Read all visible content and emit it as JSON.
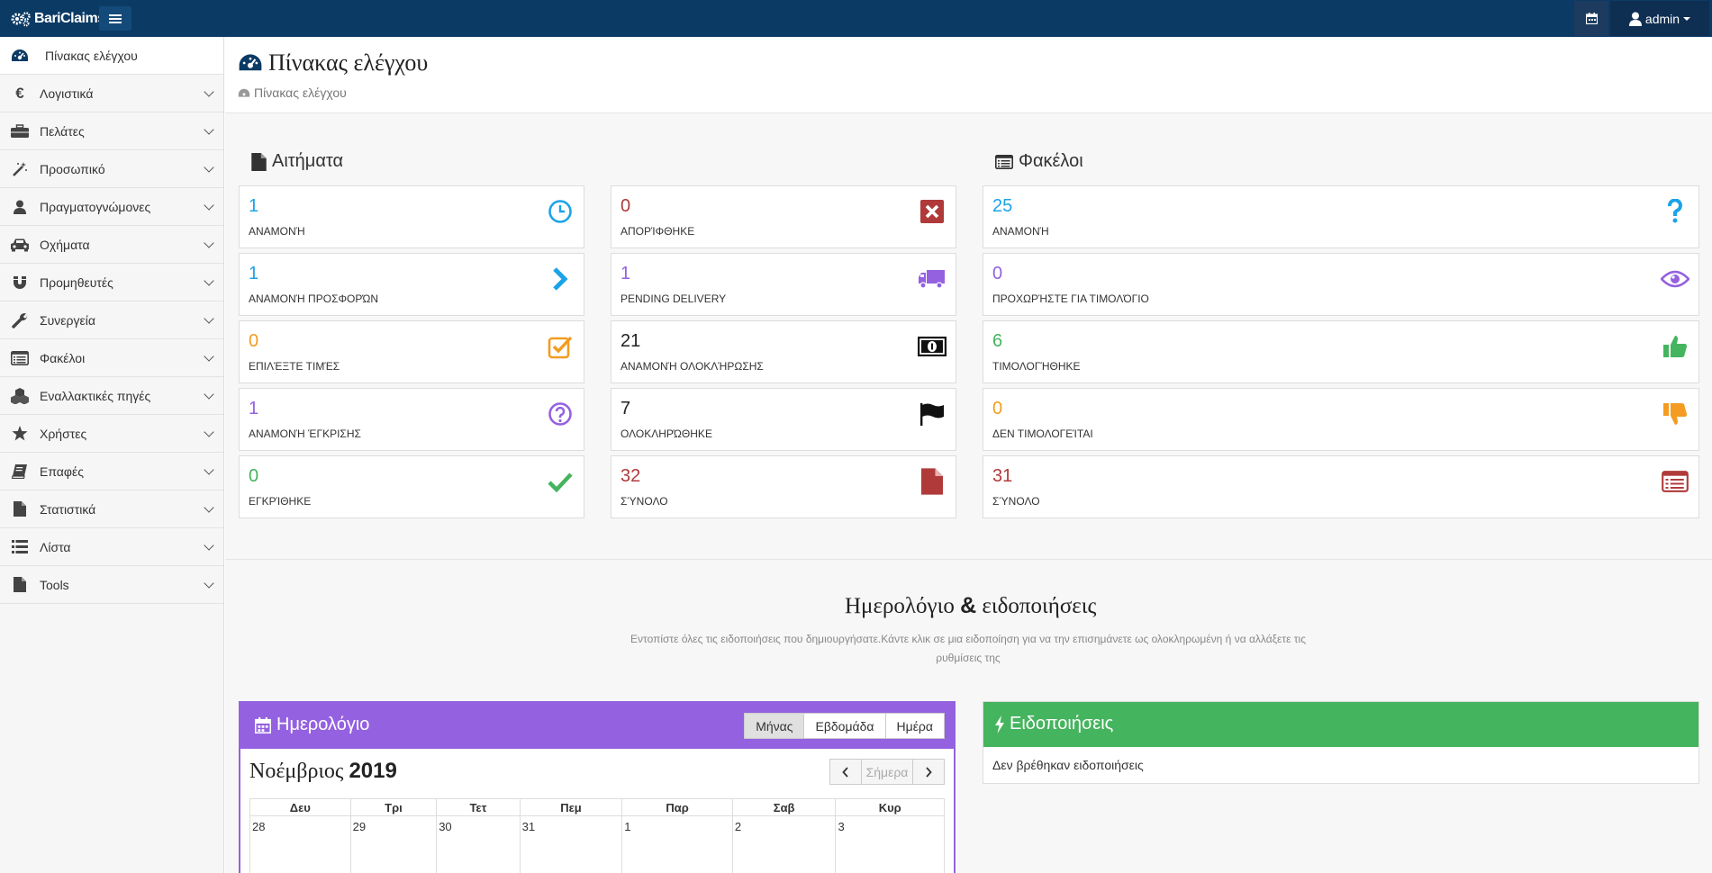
{
  "topbar": {
    "brand": "BariClaims",
    "user": "admin"
  },
  "sidebar": {
    "items": [
      {
        "label": "Πίνακας ελέγχου",
        "icon": "dashboard-icon"
      },
      {
        "label": "Λογιστικά",
        "icon": "euro-icon"
      },
      {
        "label": "Πελάτες",
        "icon": "briefcase-icon"
      },
      {
        "label": "Προσωπικό",
        "icon": "magic-wand-icon"
      },
      {
        "label": "Πραγματογνώμονες",
        "icon": "user-icon"
      },
      {
        "label": "Οχήματα",
        "icon": "car-icon"
      },
      {
        "label": "Προμηθευτές",
        "icon": "magnet-icon"
      },
      {
        "label": "Συνεργεία",
        "icon": "wrench-icon"
      },
      {
        "label": "Φακέλοι",
        "icon": "list-alt-icon"
      },
      {
        "label": "Εναλλακτικές πηγές",
        "icon": "cubes-icon"
      },
      {
        "label": "Χρήστες",
        "icon": "star-icon"
      },
      {
        "label": "Επαφές",
        "icon": "book-icon"
      },
      {
        "label": "Στατιστικά",
        "icon": "file-icon"
      },
      {
        "label": "Λίστα",
        "icon": "list-icon"
      },
      {
        "label": "Tools",
        "icon": "file-icon"
      }
    ]
  },
  "header": {
    "title": "Πίνακας ελέγχου",
    "breadcrumb": "Πίνακας ελέγχου"
  },
  "requests": {
    "title": "Αιτήματα",
    "col1": [
      {
        "value": "1",
        "label": "ΑΝΑΜΟΝΉ",
        "color": "#1ba3e8",
        "icon": "clock-icon"
      },
      {
        "value": "1",
        "label": "ΑΝΑΜΟΝΉ ΠΡΟΣΦΟΡΏΝ",
        "color": "#1ba3e8",
        "icon": "chevron-right-icon"
      },
      {
        "value": "0",
        "label": "ΕΠΙΛΈΞΤΕ ΤΙΜΈΣ",
        "color": "#f39c21",
        "icon": "check-square-icon"
      },
      {
        "value": "1",
        "label": "ΑΝΑΜΟΝΉ ΈΓΚΡΙΣΗΣ",
        "color": "#9461e0",
        "icon": "question-circle-icon"
      },
      {
        "value": "0",
        "label": "ΕΓΚΡΊΘΗΚΕ",
        "color": "#45b45e",
        "icon": "check-icon"
      }
    ],
    "col2": [
      {
        "value": "0",
        "label": "ΑΠΟΡΊΦΘΗΚΕ",
        "color": "#b03a3a",
        "icon": "times-square-icon"
      },
      {
        "value": "1",
        "label": "PENDING DELIVERY",
        "color": "#9461e0",
        "icon": "truck-icon"
      },
      {
        "value": "21",
        "label": "ΑΝΑΜΟΝΉ ΟΛΟΚΛΉΡΩΣΗΣ",
        "color": "#222222",
        "icon": "money-icon"
      },
      {
        "value": "7",
        "label": "ΟΛΟΚΛΗΡΏΘΗΚΕ",
        "color": "#222222",
        "icon": "flag-icon"
      },
      {
        "value": "32",
        "label": "ΣΎΝΟΛΟ",
        "color": "#b03a3a",
        "icon": "file-icon"
      }
    ]
  },
  "folders": {
    "title": "Φακέλοι",
    "cards": [
      {
        "value": "25",
        "label": "ΑΝΑΜΟΝΉ",
        "color": "#1ba3e8",
        "icon": "question-icon"
      },
      {
        "value": "0",
        "label": "ΠΡΟΧΩΡΉΣΤΕ ΓΙΑ ΤΙΜΟΛΌΓΙΟ",
        "color": "#9461e0",
        "icon": "eye-icon"
      },
      {
        "value": "6",
        "label": "ΤΙΜΟΛΟΓΉΘΗΚΕ",
        "color": "#45b45e",
        "icon": "thumbs-up-icon"
      },
      {
        "value": "0",
        "label": "ΔΕΝ ΤΙΜΟΛΟΓΕΊΤΑΙ",
        "color": "#f39c21",
        "icon": "thumbs-down-icon"
      },
      {
        "value": "31",
        "label": "ΣΎΝΟΛΟ",
        "color": "#b03a3a",
        "icon": "list-alt-icon"
      }
    ]
  },
  "calendar_section": {
    "heading_text": "Ημερολόγιο",
    "heading_amp": "&",
    "heading_text2": "ειδοποιήσεις",
    "description": "Εντοπίστε όλες τις ειδοποιήσεις που δημιουργήσατε.Κάντε κλικ σε μια ειδοποίηση για να την επισημάνετε ως ολοκληρωμένη ή να αλλάξετε τις ρυθμίσεις της"
  },
  "calendar": {
    "title": "Ημερολόγιο",
    "views": [
      "Μήνας",
      "Εβδομάδα",
      "Ημέρα"
    ],
    "month": "Νοέμβριος",
    "year": "2019",
    "today": "Σήμερα",
    "weekdays": [
      "Δευ",
      "Τρι",
      "Τετ",
      "Πεμ",
      "Παρ",
      "Σαβ",
      "Κυρ"
    ],
    "days": [
      "28",
      "29",
      "30",
      "31",
      "1",
      "2",
      "3"
    ]
  },
  "notifications": {
    "title": "Ειδοποιήσεις",
    "empty": "Δεν βρέθηκαν ειδοποιήσεις"
  },
  "colors": {
    "topbar": "#0b3a64",
    "calendar": "#9461e0",
    "notifications": "#45b45e"
  }
}
